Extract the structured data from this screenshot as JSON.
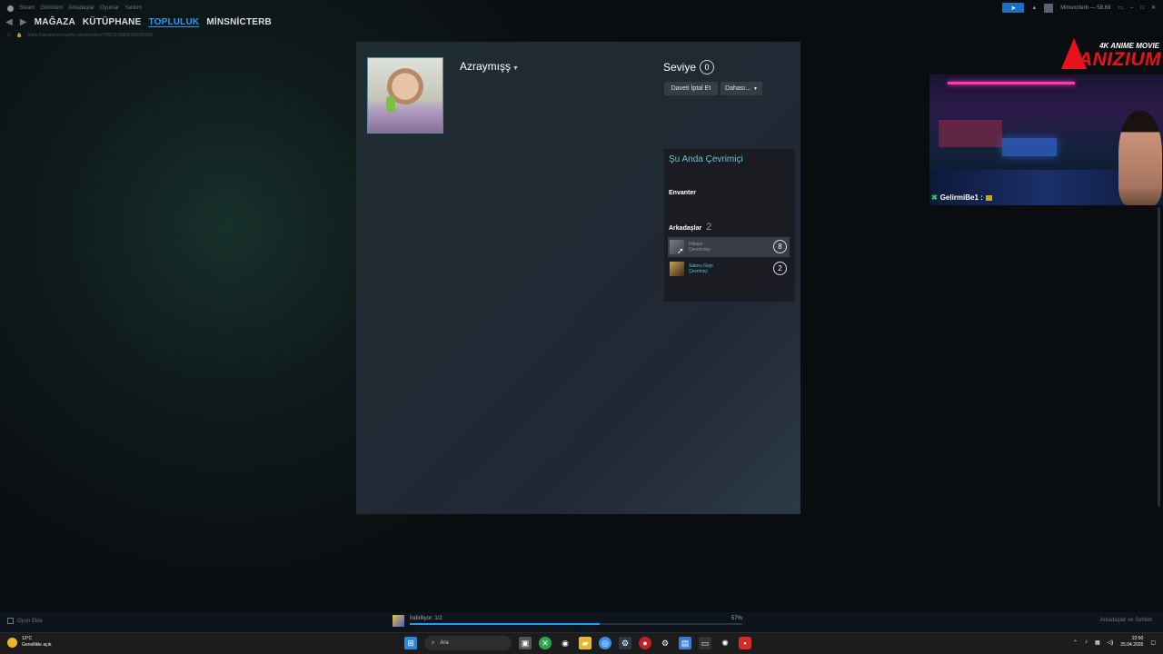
{
  "menubar": {
    "items": [
      "Steam",
      "Görünüm",
      "Arkadaşlar",
      "Oyunlar",
      "Yardım"
    ]
  },
  "nav": {
    "items": [
      "MAĞAZA",
      "KÜTÜPHANE",
      "TOPLULUK",
      "MİNSNİCTERB"
    ],
    "active": "TOPLULUK"
  },
  "urlbar": {
    "url": "https://steamcommunity.com/profiles/76561199808186093109"
  },
  "topright": {
    "account": "Minsnicterb — 58,69"
  },
  "profile": {
    "name": "Azraymışş",
    "level_label": "Seviye",
    "level": "0",
    "buttons": {
      "cancel_invite": "Daveti İptal Et",
      "more": "Dahası..."
    }
  },
  "sidebar": {
    "status": "Şu Anda Çevrimiçi",
    "inventory": "Envanter",
    "friends_label": "Arkadaşlar",
    "friends_count": "2",
    "friends": [
      {
        "name": "Hikaye",
        "status": "Çevrimdışı",
        "level": "8"
      },
      {
        "name": "Satoru Gojo",
        "status": "Çevrimiçi",
        "level": "2"
      }
    ]
  },
  "overlay": {
    "logo_sub": "4K ANIME MOVIE",
    "logo_main": "ANIZIUM",
    "chat_user": "GelirmiBe1 :"
  },
  "steambar": {
    "add_game": "Oyun Ekle",
    "download_status": "İndiriliyor: 1/2",
    "download_pct": "57%",
    "download_progress": 0.57,
    "friends_chat": "Arkadaşlar ve Sohbet"
  },
  "taskbar": {
    "temp": "13°C",
    "weather": "Genellikle açık",
    "search": "Ara",
    "time": "22:50",
    "date": "25.04.2026"
  },
  "colors": {
    "accent": "#1a9fff",
    "online": "#57cbde",
    "brand_red": "#e8121a"
  }
}
